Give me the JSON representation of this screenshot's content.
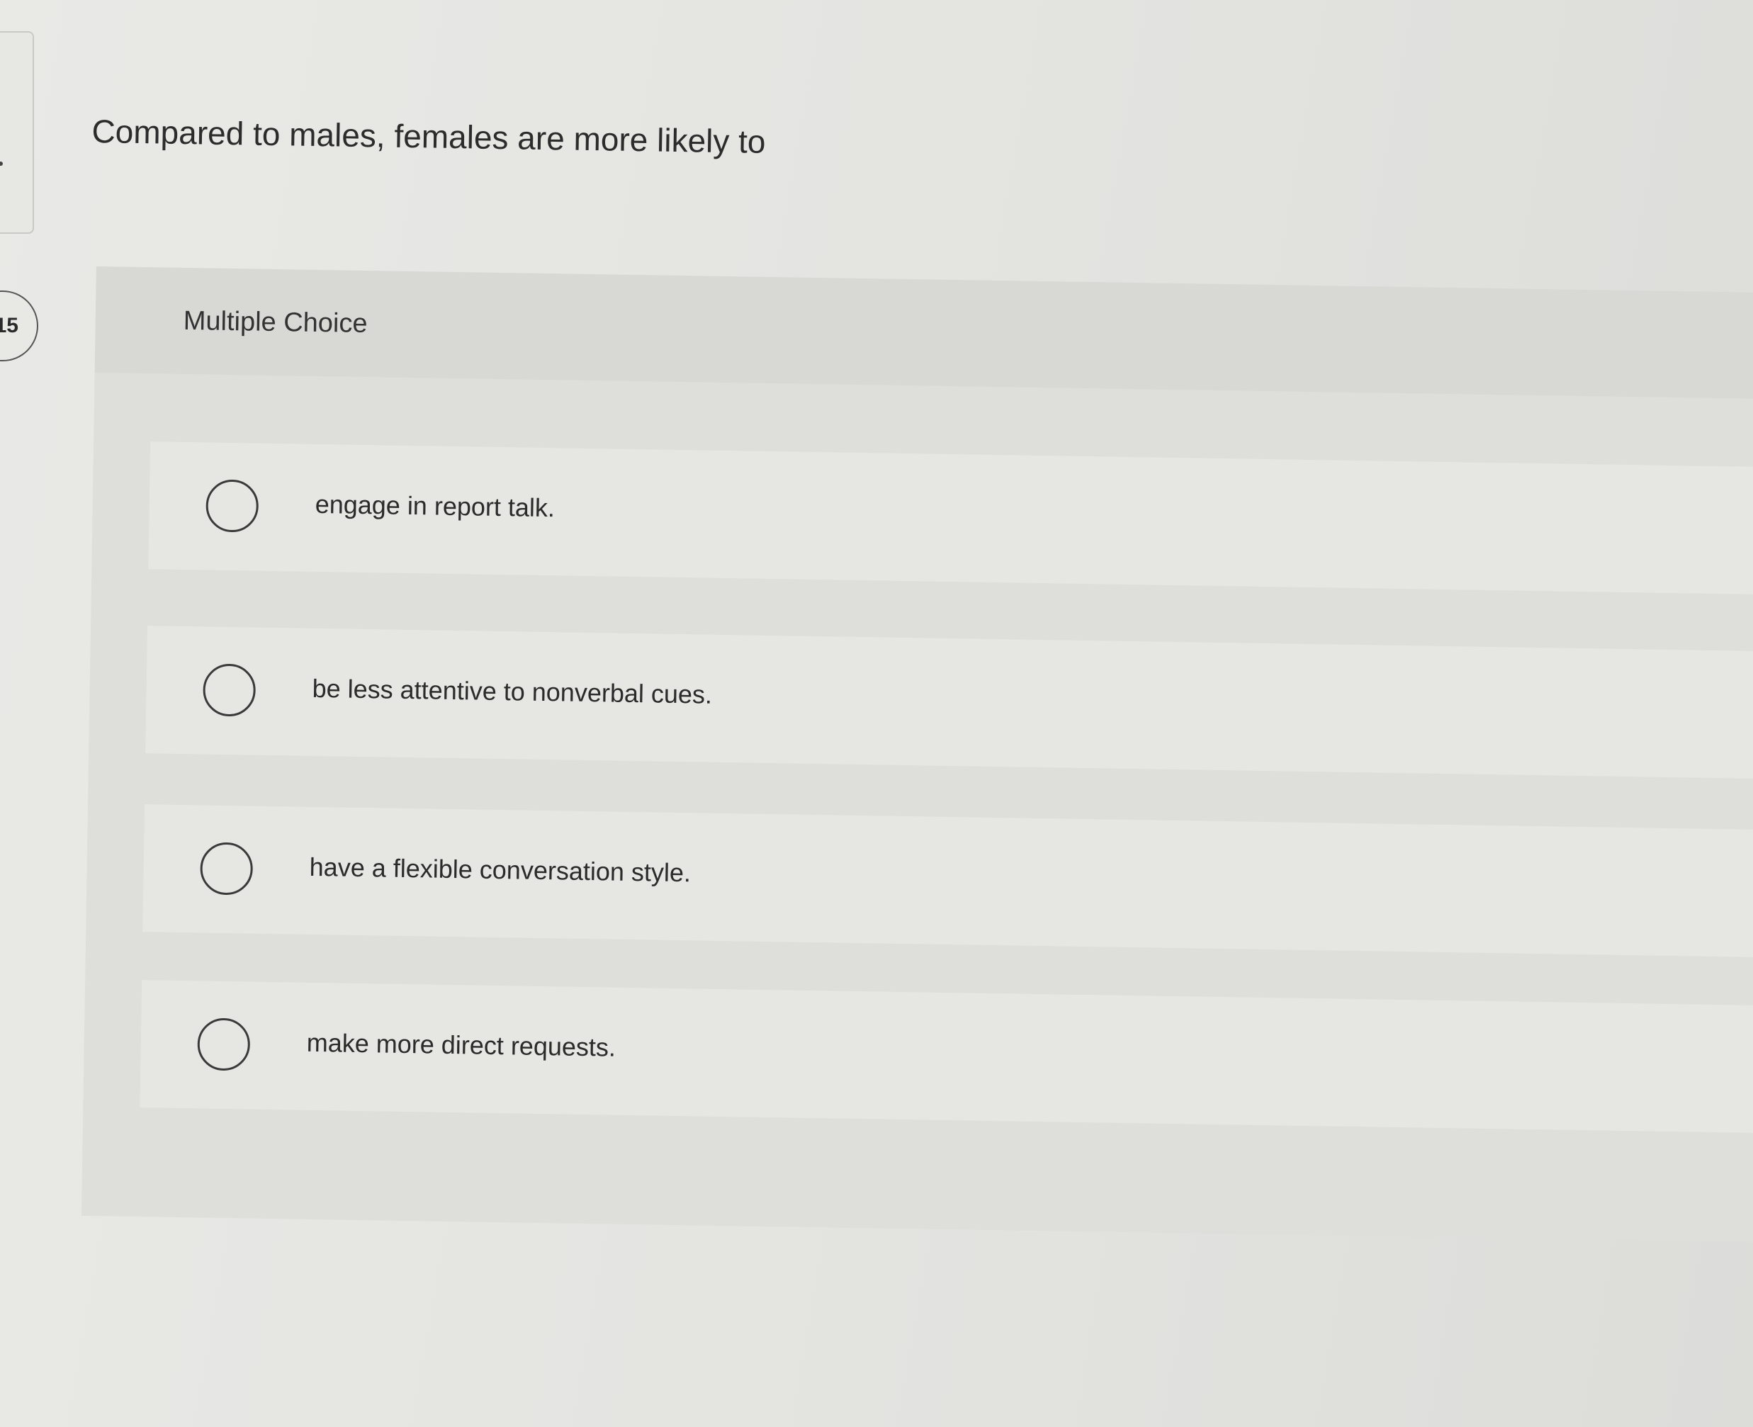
{
  "question": {
    "number": "15",
    "text": "Compared to males, females are more likely to",
    "type_label": "Multiple Choice"
  },
  "options": [
    {
      "label": "engage in report talk."
    },
    {
      "label": "be less attentive to nonverbal cues."
    },
    {
      "label": "have a flexible conversation style."
    },
    {
      "label": "make more direct requests."
    }
  ],
  "colors": {
    "page_background": "#e6e6e3",
    "panel_background": "#dededb",
    "option_background": "#e6e6e3",
    "text": "#2b2b2b"
  }
}
